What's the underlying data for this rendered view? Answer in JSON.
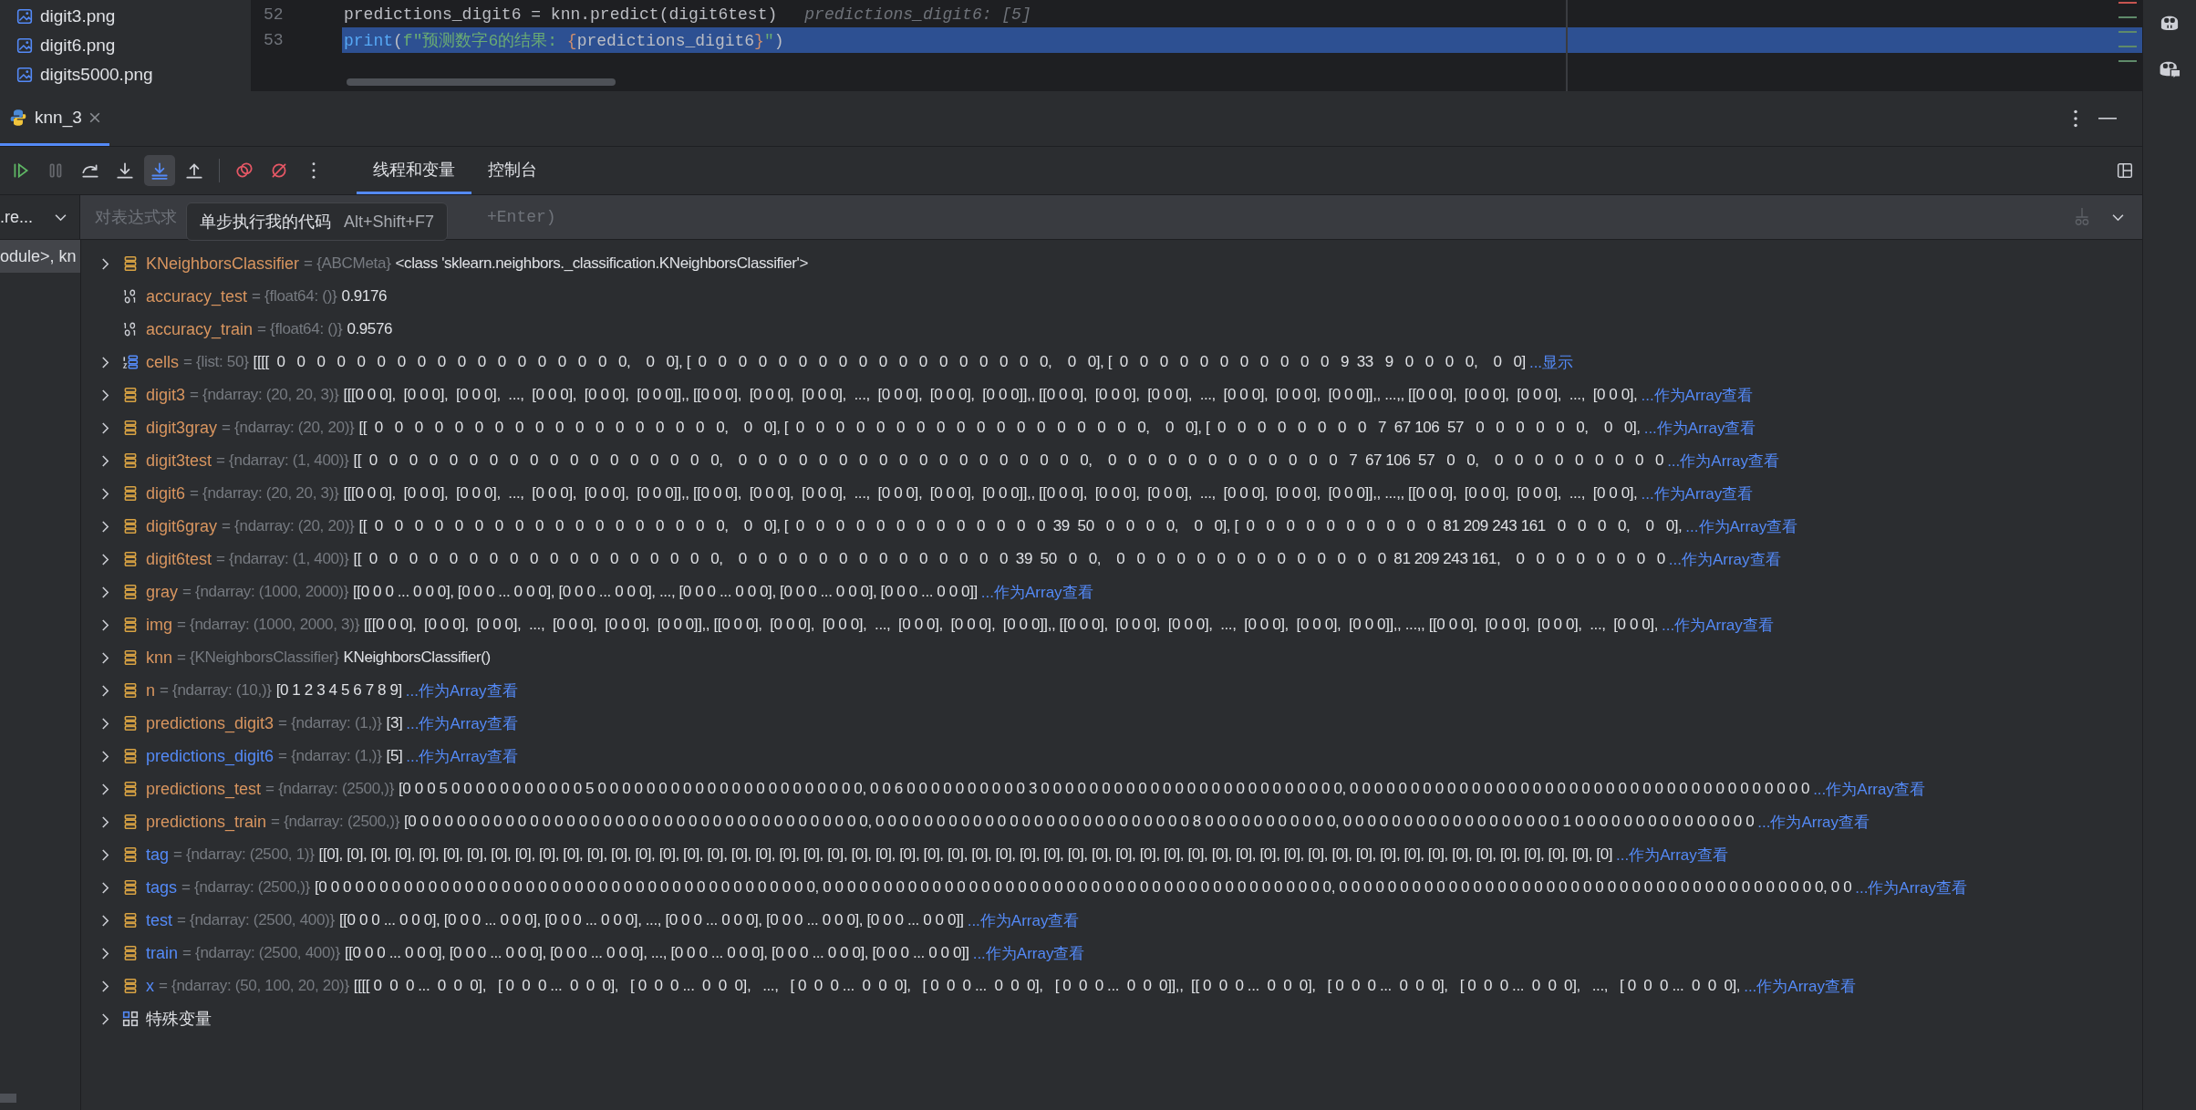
{
  "project_files": [
    "digit3.png",
    "digit6.png",
    "digits5000.png"
  ],
  "editor": {
    "lines": [
      {
        "number": "52",
        "selected": false,
        "tokens": [
          {
            "text": "predictions_digit6 = knn.predict(digit6test)",
            "kind": "plain"
          }
        ],
        "hint": "predictions_digit6: [5]"
      },
      {
        "number": "53",
        "selected": true,
        "tokens": [
          {
            "text": "print",
            "kind": "builtin"
          },
          {
            "text": "(",
            "kind": "plain"
          },
          {
            "text": "f\"预测数字6的结果: ",
            "kind": "string"
          },
          {
            "text": "{",
            "kind": "brace"
          },
          {
            "text": "predictions_digit6",
            "kind": "plain"
          },
          {
            "text": "}",
            "kind": "brace"
          },
          {
            "text": "\"",
            "kind": "string"
          },
          {
            "text": ")",
            "kind": "plain"
          }
        ]
      }
    ]
  },
  "run_tab": {
    "label": "knn_3",
    "selected": true
  },
  "toolbar_groups": [
    [
      {
        "kind": "resume",
        "disabled": false,
        "selected": false
      },
      {
        "kind": "pause",
        "disabled": true,
        "selected": false
      },
      {
        "kind": "step-over",
        "disabled": false,
        "selected": false
      },
      {
        "kind": "step-into",
        "disabled": false,
        "selected": false
      },
      {
        "kind": "step-into-my-code",
        "disabled": false,
        "selected": true
      },
      {
        "kind": "step-out",
        "disabled": false,
        "selected": false
      }
    ],
    [
      {
        "kind": "view-breakpoints",
        "disabled": false,
        "selected": false
      },
      {
        "kind": "mute-breakpoints",
        "disabled": false,
        "selected": false
      },
      {
        "kind": "more",
        "disabled": false,
        "selected": false
      }
    ]
  ],
  "tabs": [
    {
      "label": "线程和变量",
      "selected": true
    },
    {
      "label": "控制台",
      "selected": false
    }
  ],
  "frames": {
    "selector": ".re...",
    "items": [
      {
        "label": "odule>, kn",
        "selected": true
      }
    ]
  },
  "expression_field": {
    "placeholder_parts": [
      "对表达式求",
      "+Enter)"
    ]
  },
  "tooltip": {
    "text": "单步执行我的代码",
    "shortcut": "Alt+Shift+F7"
  },
  "variables": [
    {
      "kind": "object",
      "expandable": true,
      "changed": false,
      "name": "KNeighborsClassifier",
      "type": "= {ABCMeta}",
      "value": "<class 'sklearn.neighbors._classification.KNeighborsClassifier'>"
    },
    {
      "kind": "number",
      "expandable": false,
      "changed": false,
      "name": "accuracy_test",
      "type": "= {float64: ()}",
      "value": "0.9176"
    },
    {
      "kind": "number",
      "expandable": false,
      "changed": false,
      "name": "accuracy_train",
      "type": "= {float64: ()}",
      "value": "0.9576"
    },
    {
      "kind": "list",
      "expandable": true,
      "changed": false,
      "name": "cells",
      "type": "= {list: 50}",
      "value": "[[[[  0   0   0   0   0   0   0   0   0   0   0   0   0   0   0   0   0   0,    0   0], [  0   0   0   0   0   0   0   0   0   0   0   0   0   0   0   0   0   0,    0   0], [  0   0   0   0   0   0   0   0   0   0   0   9  33   9   0   0   0   0,    0   0]",
      "link": "...显示"
    },
    {
      "kind": "object",
      "expandable": true,
      "changed": false,
      "name": "digit3",
      "type": "= {ndarray: (20, 20, 3)}",
      "value": "[[[0 0 0],  [0 0 0],  [0 0 0],  ...,  [0 0 0],  [0 0 0],  [0 0 0]],, [[0 0 0],  [0 0 0],  [0 0 0],  ...,  [0 0 0],  [0 0 0],  [0 0 0]],, [[0 0 0],  [0 0 0],  [0 0 0],  ...,  [0 0 0],  [0 0 0],  [0 0 0]],, ...,, [[0 0 0],  [0 0 0],  [0 0 0],  ...,  [0 0 0],",
      "link": "...作为Array查看"
    },
    {
      "kind": "object",
      "expandable": true,
      "changed": false,
      "name": "digit3gray",
      "type": "= {ndarray: (20, 20)}",
      "value": "[[  0   0   0   0   0   0   0   0   0   0   0   0   0   0   0   0   0   0,    0   0], [  0   0   0   0   0   0   0   0   0   0   0   0   0   0   0   0   0   0,    0   0], [  0   0   0   0   0   0   0   0   7  67 106  57   0   0   0   0   0   0,    0   0],",
      "link": "...作为Array查看"
    },
    {
      "kind": "object",
      "expandable": true,
      "changed": false,
      "name": "digit3test",
      "type": "= {ndarray: (1, 400)}",
      "value": "[[  0   0   0   0   0   0   0   0   0   0   0   0   0   0   0   0   0   0,    0   0   0   0   0   0   0   0   0   0   0   0   0   0   0   0   0   0,    0   0   0   0   0   0   0   0   0   0   0   0   7  67 106  57   0   0,    0   0   0   0   0   0   0   0   0",
      "link": "...作为Array查看"
    },
    {
      "kind": "object",
      "expandable": true,
      "changed": false,
      "name": "digit6",
      "type": "= {ndarray: (20, 20, 3)}",
      "value": "[[[0 0 0],  [0 0 0],  [0 0 0],  ...,  [0 0 0],  [0 0 0],  [0 0 0]],, [[0 0 0],  [0 0 0],  [0 0 0],  ...,  [0 0 0],  [0 0 0],  [0 0 0]],, [[0 0 0],  [0 0 0],  [0 0 0],  ...,  [0 0 0],  [0 0 0],  [0 0 0]],, ...,, [[0 0 0],  [0 0 0],  [0 0 0],  ...,  [0 0 0],",
      "link": "...作为Array查看"
    },
    {
      "kind": "object",
      "expandable": true,
      "changed": false,
      "name": "digit6gray",
      "type": "= {ndarray: (20, 20)}",
      "value": "[[  0   0   0   0   0   0   0   0   0   0   0   0   0   0   0   0   0   0,    0   0], [  0   0   0   0   0   0   0   0   0   0   0   0   0  39  50   0   0   0   0,    0   0], [  0   0   0   0   0   0   0   0   0   0  81 209 243 161   0   0   0   0,    0   0],",
      "link": "...作为Array查看"
    },
    {
      "kind": "object",
      "expandable": true,
      "changed": false,
      "name": "digit6test",
      "type": "= {ndarray: (1, 400)}",
      "value": "[[  0   0   0   0   0   0   0   0   0   0   0   0   0   0   0   0   0   0,    0   0   0   0   0   0   0   0   0   0   0   0   0   0  39  50   0   0,    0   0   0   0   0   0   0   0   0   0   0   0   0   0  81 209 243 161,    0   0   0   0   0   0   0   0",
      "link": "...作为Array查看"
    },
    {
      "kind": "object",
      "expandable": true,
      "changed": false,
      "name": "gray",
      "type": "= {ndarray: (1000, 2000)}",
      "value": "[[0 0 0 ... 0 0 0], [0 0 0 ... 0 0 0], [0 0 0 ... 0 0 0], ..., [0 0 0 ... 0 0 0], [0 0 0 ... 0 0 0], [0 0 0 ... 0 0 0]]",
      "link": "...作为Array查看"
    },
    {
      "kind": "object",
      "expandable": true,
      "changed": false,
      "name": "img",
      "type": "= {ndarray: (1000, 2000, 3)}",
      "value": "[[[0 0 0],  [0 0 0],  [0 0 0],  ...,  [0 0 0],  [0 0 0],  [0 0 0]],, [[0 0 0],  [0 0 0],  [0 0 0],  ...,  [0 0 0],  [0 0 0],  [0 0 0]],, [[0 0 0],  [0 0 0],  [0 0 0],  ...,  [0 0 0],  [0 0 0],  [0 0 0]],, ...,, [[0 0 0],  [0 0 0],  [0 0 0],  ...,  [0 0 0],",
      "link": "...作为Array查看"
    },
    {
      "kind": "object",
      "expandable": true,
      "changed": false,
      "name": "knn",
      "type": "= {KNeighborsClassifier}",
      "value": "KNeighborsClassifier()"
    },
    {
      "kind": "object",
      "expandable": true,
      "changed": false,
      "name": "n",
      "type": "= {ndarray: (10,)}",
      "value": "[0 1 2 3 4 5 6 7 8 9]",
      "link": "...作为Array查看"
    },
    {
      "kind": "object",
      "expandable": true,
      "changed": false,
      "name": "predictions_digit3",
      "type": "= {ndarray: (1,)}",
      "value": "[3]",
      "link": "...作为Array查看"
    },
    {
      "kind": "object",
      "expandable": true,
      "changed": true,
      "name": "predictions_digit6",
      "type": "= {ndarray: (1,)}",
      "value": "[5]",
      "link": "...作为Array查看"
    },
    {
      "kind": "object",
      "expandable": true,
      "changed": false,
      "name": "predictions_test",
      "type": "= {ndarray: (2500,)}",
      "value": "[0 0 0 5 0 0 0 0 0 0 0 0 0 0 0 5 0 0 0 0 0 0 0 0 0 0 0 0 0 0 0 0 0 0 0 0 0 0, 0 0 6 0 0 0 0 0 0 0 0 0 0 3 0 0 0 0 0 0 0 0 0 0 0 0 0 0 0 0 0 0 0 0 0 0 0 0 0, 0 0 0 0 0 0 0 0 0 0 0 0 0 0 0 0 0 0 0 0 0 0 0 0 0 0 0 0 0 0 0 0 0 0 0 0 0 0",
      "link": "...作为Array查看"
    },
    {
      "kind": "object",
      "expandable": true,
      "changed": false,
      "name": "predictions_train",
      "type": "= {ndarray: (2500,)}",
      "value": "[0 0 0 0 0 0 0 0 0 0 0 0 0 0 0 0 0 0 0 0 0 0 0 0 0 0 0 0 0 0 0 0 0 0 0 0 0 0, 0 0 0 0 0 0 0 0 0 0 0 0 0 0 0 0 0 0 0 0 0 0 0 0 0 0 8 0 0 0 0 0 0 0 0 0 0 0, 0 0 0 0 0 0 0 0 0 0 0 0 0 0 0 0 0 0 1 0 0 0 0 0 0 0 0 0 0 0 0 0 0 0",
      "link": "...作为Array查看"
    },
    {
      "kind": "object",
      "expandable": true,
      "changed": true,
      "name": "tag",
      "type": "= {ndarray: (2500, 1)}",
      "value": "[[0], [0], [0], [0], [0], [0], [0], [0], [0], [0], [0], [0], [0], [0], [0], [0], [0], [0], [0], [0], [0], [0], [0], [0], [0], [0], [0], [0], [0], [0], [0], [0], [0], [0], [0], [0], [0], [0], [0], [0], [0], [0], [0], [0], [0], [0], [0], [0], [0], [0], [0], [0], [0], [0]",
      "link": "...作为Array查看"
    },
    {
      "kind": "object",
      "expandable": true,
      "changed": true,
      "name": "tags",
      "type": "= {ndarray: (2500,)}",
      "value": "[0 0 0 0 0 0 0 0 0 0 0 0 0 0 0 0 0 0 0 0 0 0 0 0 0 0 0 0 0 0 0 0 0 0 0 0 0 0 0 0 0, 0 0 0 0 0 0 0 0 0 0 0 0 0 0 0 0 0 0 0 0 0 0 0 0 0 0 0 0 0 0 0 0 0 0 0 0 0 0 0 0 0 0, 0 0 0 0 0 0 0 0 0 0 0 0 0 0 0 0 0 0 0 0 0 0 0 0 0 0 0 0 0 0 0 0 0 0 0 0 0 0 0 0, 0 0",
      "link": "...作为Array查看"
    },
    {
      "kind": "object",
      "expandable": true,
      "changed": true,
      "name": "test",
      "type": "= {ndarray: (2500, 400)}",
      "value": "[[0 0 0 ... 0 0 0], [0 0 0 ... 0 0 0], [0 0 0 ... 0 0 0], ..., [0 0 0 ... 0 0 0], [0 0 0 ... 0 0 0], [0 0 0 ... 0 0 0]]",
      "link": "...作为Array查看"
    },
    {
      "kind": "object",
      "expandable": true,
      "changed": true,
      "name": "train",
      "type": "= {ndarray: (2500, 400)}",
      "value": "[[0 0 0 ... 0 0 0], [0 0 0 ... 0 0 0], [0 0 0 ... 0 0 0], ..., [0 0 0 ... 0 0 0], [0 0 0 ... 0 0 0], [0 0 0 ... 0 0 0]]",
      "link": "...作为Array查看"
    },
    {
      "kind": "object",
      "expandable": true,
      "changed": true,
      "name": "x",
      "type": "= {ndarray: (50, 100, 20, 20)}",
      "value": "[[[[ 0  0  0 ...  0  0  0],   [ 0  0  0 ...  0  0  0],   [ 0  0  0 ...  0  0  0],   ...,   [ 0  0  0 ...  0  0  0],   [ 0  0  0 ...  0  0  0],   [ 0  0  0 ...  0  0  0]],,  [[ 0  0  0 ...  0  0  0],   [ 0  0  0 ...  0  0  0],   [ 0  0  0 ...  0  0  0],   ...,   [ 0  0  0 ...  0  0  0],",
      "link": "...作为Array查看"
    },
    {
      "kind": "special",
      "expandable": true,
      "changed": false,
      "name": "特殊变量"
    }
  ]
}
